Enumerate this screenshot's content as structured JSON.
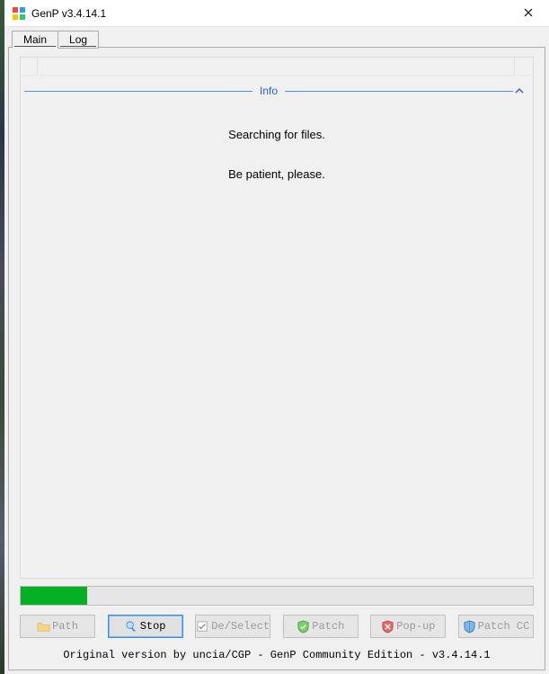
{
  "window": {
    "title": "GenP v3.4.14.1"
  },
  "tabs": {
    "main": "Main",
    "log": "Log"
  },
  "info": {
    "heading": "Info",
    "line1": "Searching for files.",
    "line2": "Be patient, please."
  },
  "progress": {
    "percent": 13
  },
  "buttons": {
    "path": "Path",
    "stop": "Stop",
    "deselect": "De/Select",
    "patch": "Patch",
    "popup": "Pop-up",
    "patchcc": "Patch CC"
  },
  "footer": {
    "text": "Original version by uncia/CGP - GenP Community Edition - v3.4.14.1"
  }
}
